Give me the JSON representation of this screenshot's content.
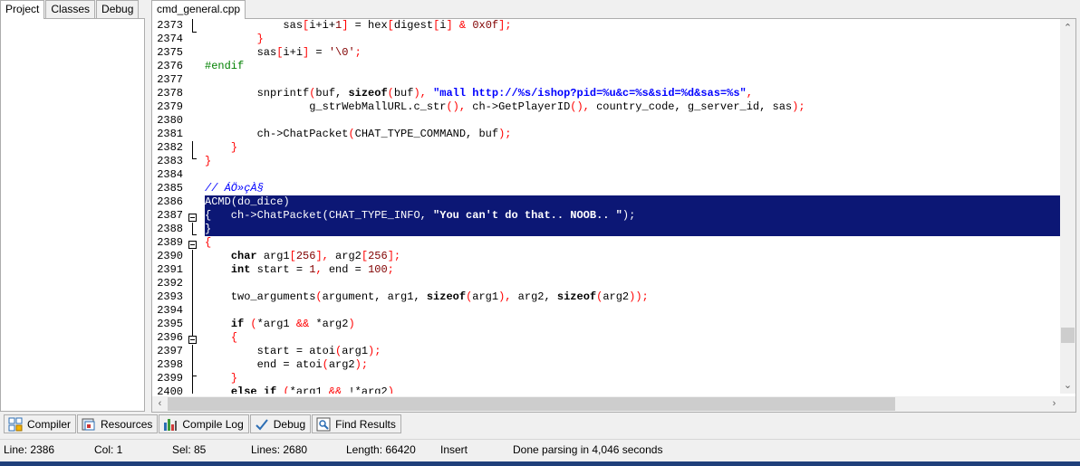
{
  "left_tabs": [
    "Project",
    "Classes",
    "Debug"
  ],
  "file_tab": "cmd_general.cpp",
  "editor": {
    "lines": [
      {
        "n": "2373",
        "parts": [
          [
            "",
            "            sas"
          ],
          [
            "sym",
            "["
          ],
          [
            "",
            "i+i+"
          ],
          [
            "num",
            "1"
          ],
          [
            "sym",
            "]"
          ],
          [
            "",
            " = hex"
          ],
          [
            "sym",
            "["
          ],
          [
            "",
            "digest"
          ],
          [
            "sym",
            "["
          ],
          [
            "",
            "i"
          ],
          [
            "sym",
            "]"
          ],
          [
            "",
            " "
          ],
          [
            "sym",
            "&"
          ],
          [
            "",
            " "
          ],
          [
            "num",
            "0x0f"
          ],
          [
            "sym",
            "];"
          ]
        ]
      },
      {
        "n": "2374",
        "parts": [
          [
            "",
            "        "
          ],
          [
            "sym",
            "}"
          ]
        ]
      },
      {
        "n": "2375",
        "parts": [
          [
            "",
            "        sas"
          ],
          [
            "sym",
            "["
          ],
          [
            "",
            "i+i"
          ],
          [
            "sym",
            "]"
          ],
          [
            "",
            " = "
          ],
          [
            "num",
            "'\\0'"
          ],
          [
            "sym",
            ";"
          ]
        ]
      },
      {
        "n": "2376",
        "parts": [
          [
            "pp",
            "#endif"
          ]
        ]
      },
      {
        "n": "2377",
        "parts": [
          [
            "",
            ""
          ]
        ]
      },
      {
        "n": "2378",
        "parts": [
          [
            "",
            "        snprintf"
          ],
          [
            "sym",
            "("
          ],
          [
            "",
            "buf, "
          ],
          [
            "kw",
            "sizeof"
          ],
          [
            "sym",
            "("
          ],
          [
            "",
            "buf"
          ],
          [
            "sym",
            "),"
          ],
          [
            "",
            " "
          ],
          [
            "str",
            "\"mall http://%s/ishop?pid=%u&c=%s&sid=%d&sas=%s\""
          ],
          [
            "sym",
            ","
          ]
        ]
      },
      {
        "n": "2379",
        "parts": [
          [
            "",
            "                g_strWebMallURL.c_str"
          ],
          [
            "sym",
            "(),"
          ],
          [
            "",
            " ch->GetPlayerID"
          ],
          [
            "sym",
            "(),"
          ],
          [
            "",
            " country_code, g_server_id, sas"
          ],
          [
            "sym",
            ");"
          ]
        ]
      },
      {
        "n": "2380",
        "parts": [
          [
            "",
            ""
          ]
        ]
      },
      {
        "n": "2381",
        "parts": [
          [
            "",
            "        ch->ChatPacket"
          ],
          [
            "sym",
            "("
          ],
          [
            "",
            "CHAT_TYPE_COMMAND, buf"
          ],
          [
            "sym",
            ");"
          ]
        ]
      },
      {
        "n": "2382",
        "parts": [
          [
            "",
            "    "
          ],
          [
            "sym",
            "}"
          ]
        ]
      },
      {
        "n": "2383",
        "parts": [
          [
            "sym",
            "}"
          ]
        ]
      },
      {
        "n": "2384",
        "parts": [
          [
            "",
            ""
          ]
        ]
      },
      {
        "n": "2385",
        "parts": [
          [
            "cmt",
            "// ÁÖ»çÀ§"
          ]
        ]
      },
      {
        "n": "2386",
        "sel": true,
        "parts": [
          [
            "",
            "ACMD"
          ],
          [
            "sym",
            "("
          ],
          [
            "",
            "do_dice"
          ],
          [
            "sym",
            ")"
          ]
        ]
      },
      {
        "n": "2387",
        "sel": true,
        "parts": [
          [
            "sym",
            "{"
          ],
          [
            "",
            "   ch->ChatPacket"
          ],
          [
            "sym",
            "("
          ],
          [
            "",
            "CHAT_TYPE_INFO, "
          ],
          [
            "str",
            "\"You can't do that.. NOOB.. \""
          ],
          [
            "sym",
            ");"
          ]
        ]
      },
      {
        "n": "2388",
        "sel": true,
        "parts": [
          [
            "sym",
            "}"
          ]
        ]
      },
      {
        "n": "2389",
        "parts": [
          [
            "sym",
            "{"
          ]
        ]
      },
      {
        "n": "2390",
        "parts": [
          [
            "",
            "    "
          ],
          [
            "kw",
            "char"
          ],
          [
            "",
            " arg1"
          ],
          [
            "sym",
            "["
          ],
          [
            "num",
            "256"
          ],
          [
            "sym",
            "],"
          ],
          [
            "",
            " arg2"
          ],
          [
            "sym",
            "["
          ],
          [
            "num",
            "256"
          ],
          [
            "sym",
            "];"
          ]
        ]
      },
      {
        "n": "2391",
        "parts": [
          [
            "",
            "    "
          ],
          [
            "kw",
            "int"
          ],
          [
            "",
            " start = "
          ],
          [
            "num",
            "1"
          ],
          [
            "sym",
            ","
          ],
          [
            "",
            " end = "
          ],
          [
            "num",
            "100"
          ],
          [
            "sym",
            ";"
          ]
        ]
      },
      {
        "n": "2392",
        "parts": [
          [
            "",
            ""
          ]
        ]
      },
      {
        "n": "2393",
        "parts": [
          [
            "",
            "    two_arguments"
          ],
          [
            "sym",
            "("
          ],
          [
            "",
            "argument, arg1, "
          ],
          [
            "kw",
            "sizeof"
          ],
          [
            "sym",
            "("
          ],
          [
            "",
            "arg1"
          ],
          [
            "sym",
            "),"
          ],
          [
            "",
            " arg2, "
          ],
          [
            "kw",
            "sizeof"
          ],
          [
            "sym",
            "("
          ],
          [
            "",
            "arg2"
          ],
          [
            "sym",
            "));"
          ]
        ]
      },
      {
        "n": "2394",
        "parts": [
          [
            "",
            ""
          ]
        ]
      },
      {
        "n": "2395",
        "parts": [
          [
            "",
            "    "
          ],
          [
            "kw",
            "if"
          ],
          [
            "",
            " "
          ],
          [
            "sym",
            "("
          ],
          [
            "",
            "*arg1 "
          ],
          [
            "sym",
            "&&"
          ],
          [
            "",
            " *arg2"
          ],
          [
            "sym",
            ")"
          ]
        ]
      },
      {
        "n": "2396",
        "parts": [
          [
            "",
            "    "
          ],
          [
            "sym",
            "{"
          ]
        ]
      },
      {
        "n": "2397",
        "parts": [
          [
            "",
            "        start = atoi"
          ],
          [
            "sym",
            "("
          ],
          [
            "",
            "arg1"
          ],
          [
            "sym",
            ");"
          ]
        ]
      },
      {
        "n": "2398",
        "parts": [
          [
            "",
            "        end = atoi"
          ],
          [
            "sym",
            "("
          ],
          [
            "",
            "arg2"
          ],
          [
            "sym",
            ");"
          ]
        ]
      },
      {
        "n": "2399",
        "parts": [
          [
            "",
            "    "
          ],
          [
            "sym",
            "}"
          ]
        ]
      },
      {
        "n": "2400",
        "parts": [
          [
            "",
            "    "
          ],
          [
            "kw",
            "else"
          ],
          [
            "",
            " "
          ],
          [
            "kw",
            "if"
          ],
          [
            "",
            " "
          ],
          [
            "sym",
            "("
          ],
          [
            "",
            "*arg1 "
          ],
          [
            "sym",
            "&&"
          ],
          [
            "",
            " !*arg2"
          ],
          [
            "sym",
            ")"
          ]
        ]
      }
    ]
  },
  "bottom_tabs": [
    {
      "label": "Compiler",
      "icon": "compiler-icon"
    },
    {
      "label": "Resources",
      "icon": "resources-icon"
    },
    {
      "label": "Compile Log",
      "icon": "compile-log-icon"
    },
    {
      "label": "Debug",
      "icon": "debug-icon"
    },
    {
      "label": "Find Results",
      "icon": "find-results-icon"
    }
  ],
  "status": {
    "line": "Line:  2386",
    "col": "Col:     1",
    "sel": "Sel:    85",
    "lines": "Lines:  2680",
    "length": "Length: 66420",
    "mode": "Insert",
    "message": "Done parsing in 4,046 seconds"
  }
}
